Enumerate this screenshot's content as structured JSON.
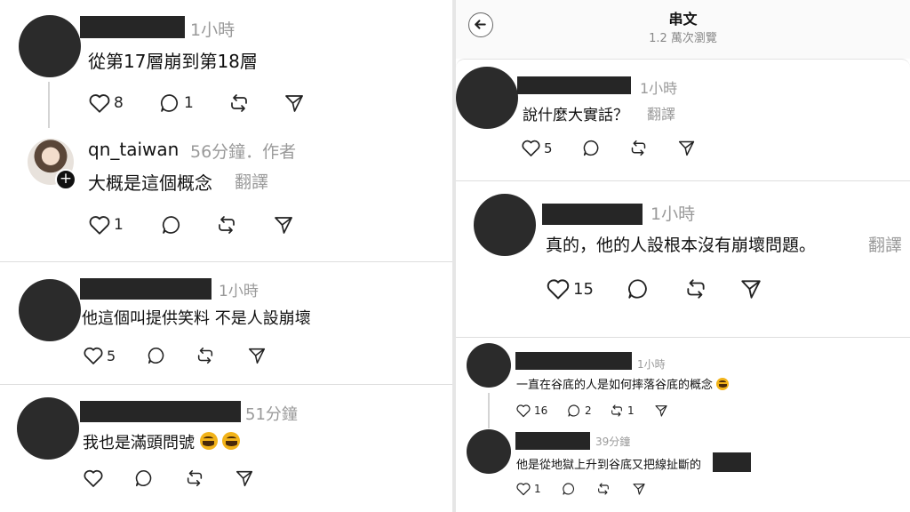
{
  "left_comments": {
    "c1": {
      "time": "1小時",
      "text": "從第17層崩到第18層",
      "likes": "8",
      "replies": "1"
    },
    "c2": {
      "username": "qn_taiwan",
      "meta": "56分鐘．作者",
      "text": "大概是這個概念",
      "translate": "翻譯",
      "likes": "1"
    },
    "c3": {
      "time": "1小時",
      "text": "他這個叫提供笑料 不是人設崩壞",
      "likes": "5"
    },
    "c4": {
      "time": "51分鐘",
      "text": "我也是滿頭問號"
    }
  },
  "thread_header": {
    "title": "串文",
    "views": "1.2 萬次瀏覽"
  },
  "right_comments": {
    "r1": {
      "time": "1小時",
      "text": "說什麼大實話？",
      "translate": "翻譯",
      "likes": "5"
    },
    "r2": {
      "time": "1小時",
      "text": "真的，他的人設根本沒有崩壞問題。",
      "translate": "翻譯",
      "likes": "15"
    },
    "r3": {
      "time": "1小時",
      "text": "一直在谷底的人是如何摔落谷底的概念",
      "likes": "16",
      "replies": "2",
      "reposts": "1"
    },
    "r4": {
      "time": "39分鐘",
      "text": "他是從地獄上升到谷底又把線扯斷的",
      "likes": "1"
    }
  },
  "icons": [
    "heart-icon",
    "comment-icon",
    "repost-icon",
    "share-icon",
    "back-arrow-icon",
    "follow-plus-icon"
  ]
}
